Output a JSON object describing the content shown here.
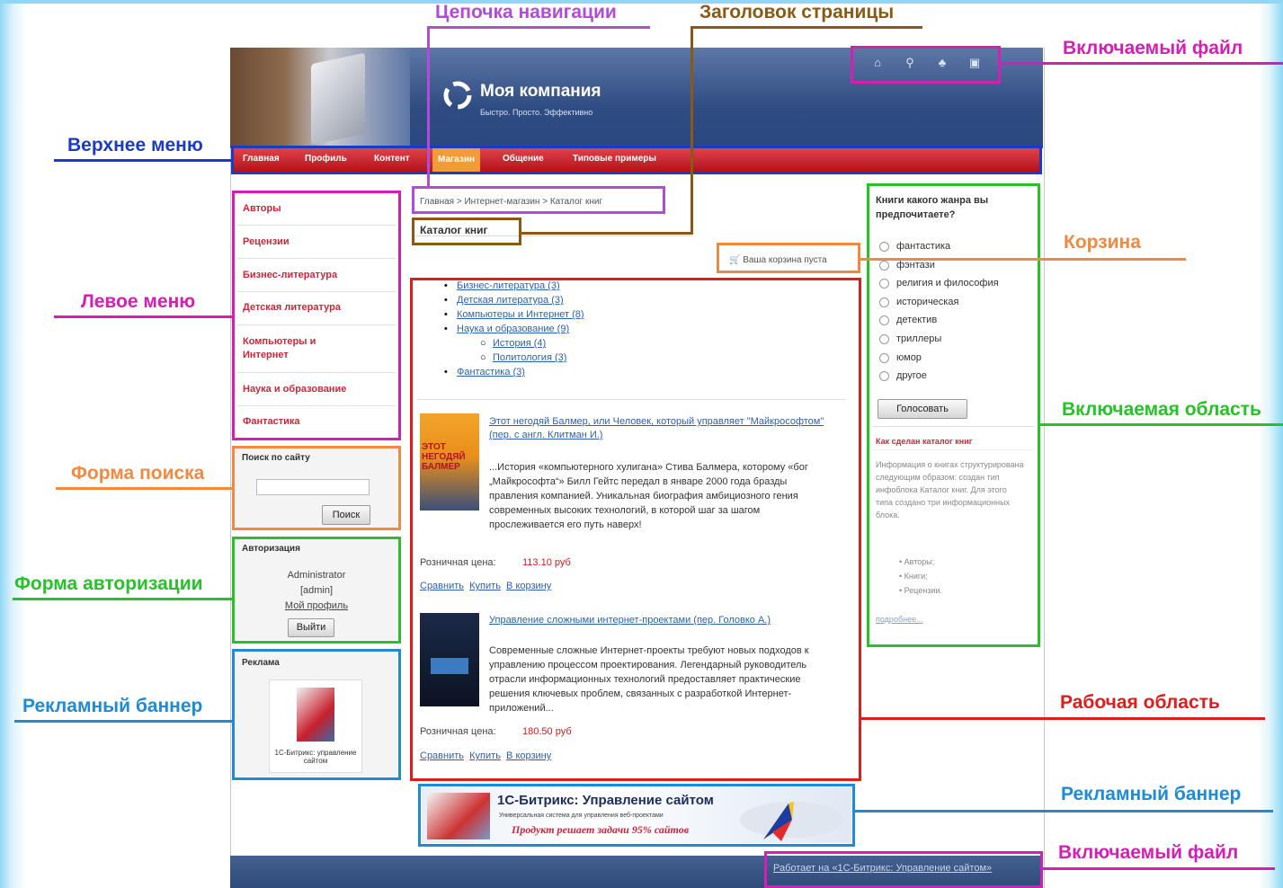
{
  "annotations": {
    "breadcrumb_chain": "Цепочка навигации",
    "page_title": "Заголовок страницы",
    "include_file_top": "Включаемый файл",
    "top_menu": "Верхнее меню",
    "cart": "Корзина",
    "left_menu": "Левое меню",
    "include_area": "Включаемая область",
    "search_form": "Форма поиска",
    "auth_form": "Форма авторизации",
    "ad_banner_left": "Рекламный баннер",
    "work_area": "Рабочая область",
    "ad_banner_bottom": "Рекламный баннер",
    "include_file_bottom": "Включаемый файл"
  },
  "colors": {
    "blue": "#1a3cc4",
    "brown": "#8a5a14",
    "magenta": "#d51fb4",
    "orange": "#f08a43",
    "green": "#27c227",
    "red": "#e01d1d",
    "steelblue": "#1f8ad6"
  },
  "site": {
    "logo_title": "Моя компания",
    "logo_slogan": "Быстро. Просто. Эффективно",
    "top_icons": [
      "home-icon",
      "search-icon",
      "sitemap-icon",
      "print-icon"
    ],
    "menu": [
      "Главная",
      "Профиль",
      "Контент",
      "Магазин",
      "Общение",
      "Типовые примеры"
    ],
    "breadcrumb": "Главная > Интернет-магазин > Каталог книг",
    "page_title": "Каталог книг",
    "cart_text": "Ваша корзина пуста",
    "left_menu": [
      "Авторы",
      "Рецензии",
      "Бизнес-литература",
      "Детская литература",
      "Компьютеры и Интернет",
      "Наука и образование",
      "Фантастика"
    ],
    "search_title": "Поиск по сайту",
    "search_button": "Поиск",
    "auth_title": "Авторизация",
    "auth_user": "Administrator",
    "auth_login": "[admin]",
    "auth_profile": "Мой профиль",
    "auth_logout": "Выйти",
    "ad_title": "Реклама",
    "ad_caption": "1С-Битрикс: управление сайтом",
    "categories": [
      "Бизнес-литература (3)",
      "Детская литература (3)",
      "Компьютеры и Интернет (8)",
      "Наука и образование (9)"
    ],
    "subcategories": [
      "История (4)",
      "Политология (3)"
    ],
    "categories_last": "Фантастика (3)",
    "book1": {
      "title": "Этот негодяй Балмер, или Человек, который управляет \"Майкрософтом\" (пер. с англ. Клитман И.)",
      "cover": "ЭТОТ НЕГОДЯЙ БАЛМЕР",
      "desc": "...История «компьютерного хулигана» Стива Балмера, которому «бог „Майкрософта“» Билл Гейтс передал в январе 2000 года бразды правления компанией. Уникальная биография амбициозного гения современных высоких технологий, в которой шаг за шагом прослеживается его путь наверх!",
      "price_label": "Розничная цена:",
      "price": "113.10 руб"
    },
    "book2": {
      "title": "Управление сложными интернет-проектами (пер. Головко А.)",
      "desc": "Современные сложные Интернет-проекты требуют новых подходов к управлению процессом проектирования. Легендарный руководитель отрасли информационных технологий предоставляет практические решения ключевых проблем, связанных с разработкой Интернет-приложений...",
      "price_label": "Розничная цена:",
      "price": "180.50 руб"
    },
    "actions": [
      "Сравнить",
      "Купить",
      "В корзину"
    ],
    "poll_question": "Книги какого жанра вы предпочитаете?",
    "poll_options": [
      "фантастика",
      "фэнтази",
      "религия и философия",
      "историческая",
      "детектив",
      "триллеры",
      "юмор",
      "другое"
    ],
    "poll_button": "Голосовать",
    "info_title": "Как сделан каталог книг",
    "info_text": "Информация о книгах структурирована следующим образом: создан тип инфоблока Каталог книг. Для этого типа создано три информационных блока.",
    "info_list": [
      "Авторы;",
      "Книги;",
      "Рецензии."
    ],
    "info_more": "подробнее...",
    "banner_title": "1С-Битрикс: Управление сайтом",
    "banner_sub": "Универсальная система для управления веб-проектами",
    "banner_slogan": "Продукт решает задачи 95% сайтов",
    "footer_link": "Работает на «1С-Битрикс: Управление сайтом»"
  }
}
